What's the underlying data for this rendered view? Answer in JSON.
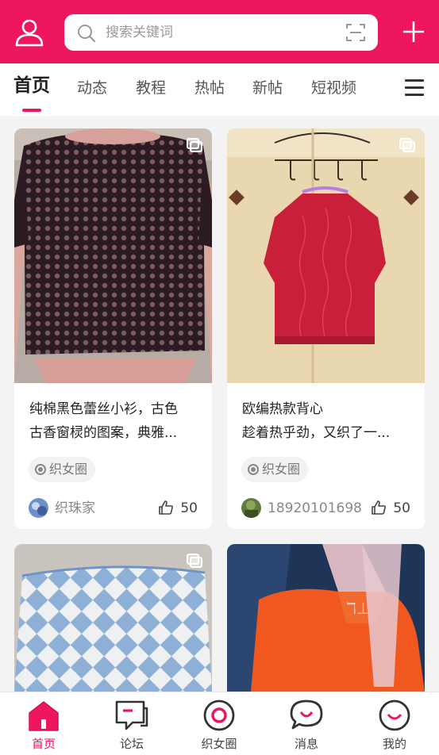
{
  "colors": {
    "brand": "#ee175f",
    "background": "#f3f3f3"
  },
  "header": {
    "search_placeholder": "搜索关键词",
    "icons": [
      "user-icon",
      "search-icon",
      "scan-icon",
      "plus-icon"
    ]
  },
  "tabs": [
    {
      "label": "首页",
      "active": true
    },
    {
      "label": "动态"
    },
    {
      "label": "教程"
    },
    {
      "label": "热帖"
    },
    {
      "label": "新帖"
    },
    {
      "label": "短视频"
    }
  ],
  "posts": [
    {
      "title_line1": "纯棉黑色蕾丝小衫，古色",
      "title_line2": "古香窗棂的图案，典雅...",
      "tag": "织女圈",
      "author": "织珠家",
      "likes": "50"
    },
    {
      "title_line1": "欧编热款背心",
      "title_line2": "趁着热乎劲，又织了一...",
      "tag": "织女圈",
      "author": "18920101698",
      "likes": "50"
    },
    {},
    {}
  ],
  "bottom_nav": [
    {
      "label": "首页",
      "icon": "home-icon",
      "active": true
    },
    {
      "label": "论坛",
      "icon": "forum-icon"
    },
    {
      "label": "织女圈",
      "icon": "circle-icon"
    },
    {
      "label": "消息",
      "icon": "message-icon"
    },
    {
      "label": "我的",
      "icon": "profile-icon"
    }
  ]
}
